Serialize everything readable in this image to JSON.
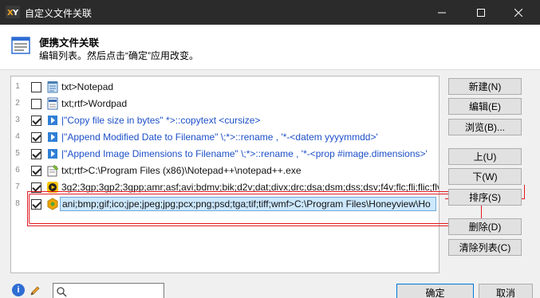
{
  "window": {
    "title": "自定义文件关联",
    "icon": "app-logo-icon"
  },
  "header": {
    "title": "便携文件关联",
    "subtitle": "编辑列表。然后点击“确定”应用改变。"
  },
  "list": {
    "rows": [
      {
        "number": "1",
        "checked": false,
        "icon": "notepad-icon",
        "text": "txt>Notepad",
        "style": "normal"
      },
      {
        "number": "2",
        "checked": false,
        "icon": "wordpad-icon",
        "text": "txt;rtf>Wordpad",
        "style": "normal"
      },
      {
        "number": "3",
        "checked": true,
        "icon": "script-icon",
        "text": "|\"Copy file size in bytes\" *>::copytext <cursize>",
        "style": "blue"
      },
      {
        "number": "4",
        "checked": true,
        "icon": "script-icon",
        "text": "|\"Append Modified Date to Filename\" \\;*>::rename , '*-<datem yyyymmdd>'",
        "style": "blue"
      },
      {
        "number": "5",
        "checked": true,
        "icon": "script-icon",
        "text": "|\"Append Image Dimensions to Filename\" \\;*>::rename , '*-<prop #image.dimensions>'",
        "style": "blue"
      },
      {
        "number": "6",
        "checked": true,
        "icon": "notepadpp-icon",
        "text": "txt;rtf>C:\\Program Files (x86)\\Notepad++\\notepad++.exe",
        "style": "normal"
      },
      {
        "number": "7",
        "checked": true,
        "icon": "media-player-icon",
        "text": "3g2;3gp;3gp2;3gpp;amr;asf;avi;bdmv;bik;d2v;dat;divx;drc;dsa;dsm;dss;dsv;f4v;flc;fli;flic;flv",
        "style": "normal"
      },
      {
        "number": "8",
        "checked": true,
        "icon": "honeyview-icon",
        "text": "ani;bmp;gif;ico;jpe;jpeg;jpg;pcx;png;psd;tga;tif;tiff;wmf>C:\\Program Files\\Honeyview\\Ho",
        "style": "selected"
      }
    ]
  },
  "buttons": {
    "new": "新建(N)",
    "edit": "编辑(E)",
    "browse": "浏览(B)...",
    "up": "上(U)",
    "down": "下(W)",
    "sort": "排序(S)",
    "delete": "删除(D)",
    "clear": "清除列表(C)"
  },
  "footer": {
    "search_value": "",
    "ok": "确定",
    "cancel": "取消"
  },
  "colors": {
    "titlebar": "#2b2b2b",
    "selection": "#cce8ff",
    "annotation_red": "#e21b23",
    "script_blue": "#1e50c8"
  }
}
